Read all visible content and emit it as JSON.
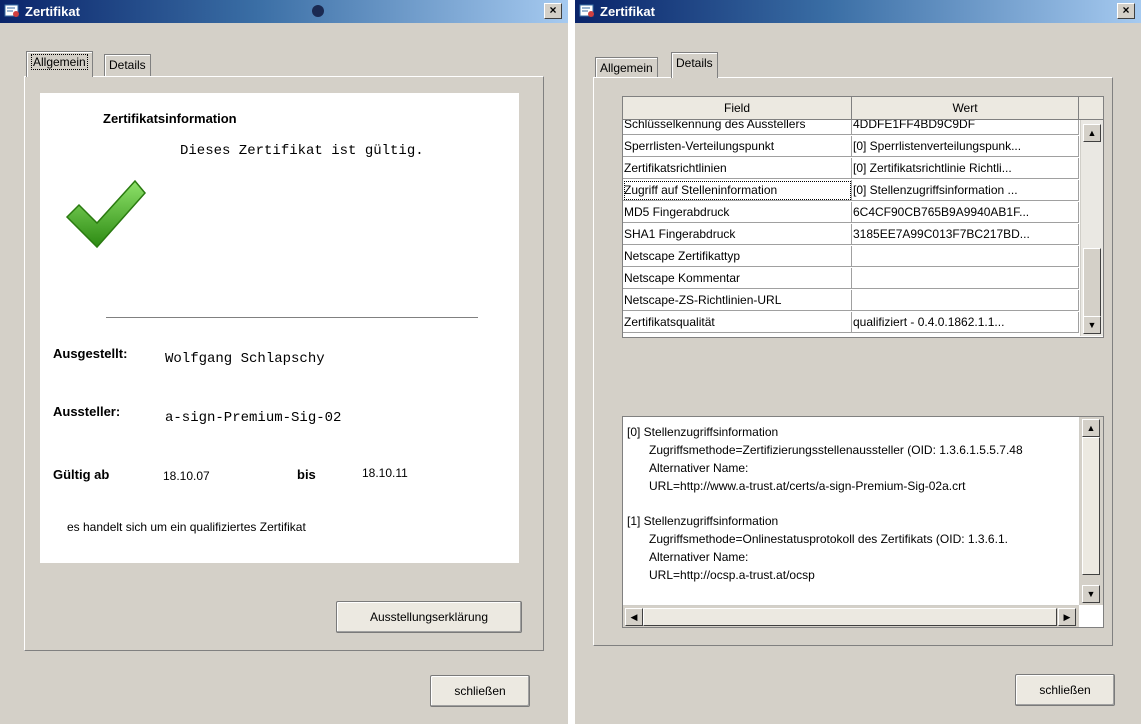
{
  "left_window": {
    "title": "Zertifikat",
    "close_label": "×",
    "tabs": [
      {
        "label": "Allgemein"
      },
      {
        "label": "Details"
      }
    ],
    "info_heading": "Zertifikatsinformation",
    "valid_text": "Dieses Zertifikat ist gültig.",
    "issued_to_label": "Ausgestellt:",
    "issued_to_value": "Wolfgang Schlapschy",
    "issuer_label": "Aussteller:",
    "issuer_value": "a-sign-Premium-Sig-02",
    "valid_from_label": "Gültig ab",
    "valid_from_value": "18.10.07",
    "until_label": "bis",
    "until_value": "18.10.11",
    "qualified_note": "es handelt sich um ein qualifiziertes Zertifikat",
    "issuer_statement_button": "Ausstellungserklärung",
    "close_button": "schließen"
  },
  "right_window": {
    "title": "Zertifikat",
    "close_label": "×",
    "tabs": [
      {
        "label": "Allgemein"
      },
      {
        "label": "Details"
      }
    ],
    "table_headers": {
      "field": "Field",
      "value": "Wert"
    },
    "rows": [
      {
        "field": "Schlüsselkennung des Ausstellers",
        "value": "4DDFE1FF4BD9C9DF"
      },
      {
        "field": "Sperrlisten-Verteilungspunkt",
        "value": "[0] Sperrlistenverteilungspunk..."
      },
      {
        "field": "Zertifikatsrichtlinien",
        "value": "[0] Zertifikatsrichtlinie    Richtli..."
      },
      {
        "field": "Zugriff auf Stelleninformation",
        "value": "[0] Stellenzugriffsinformation  ..."
      },
      {
        "field": "MD5 Fingerabdruck",
        "value": "6C4CF90CB765B9A9940AB1F..."
      },
      {
        "field": "SHA1 Fingerabdruck",
        "value": "3185EE7A99C013F7BC217BD..."
      },
      {
        "field": "Netscape Zertifikattyp",
        "value": ""
      },
      {
        "field": "Netscape Kommentar",
        "value": ""
      },
      {
        "field": "Netscape-ZS-Richtlinien-URL",
        "value": ""
      },
      {
        "field": "Zertifikatsqualität",
        "value": "qualifiziert    - 0.4.0.1862.1.1..."
      }
    ],
    "detail_lines": [
      "[0] Stellenzugriffsinformation",
      "Zugriffsmethode=Zertifizierungsstellenaussteller (OID: 1.3.6.1.5.5.7.48",
      "Alternativer Name:",
      "URL=http://www.a-trust.at/certs/a-sign-Premium-Sig-02a.crt",
      "[1] Stellenzugriffsinformation",
      "Zugriffsmethode=Onlinestatusprotokoll des Zertifikats (OID: 1.3.6.1.",
      "Alternativer Name:",
      "URL=http://ocsp.a-trust.at/ocsp"
    ],
    "close_button": "schließen"
  },
  "colors": {
    "titlebar_start": "#0a246a",
    "titlebar_end": "#a6caf0",
    "check_green": "#3ea51c"
  }
}
